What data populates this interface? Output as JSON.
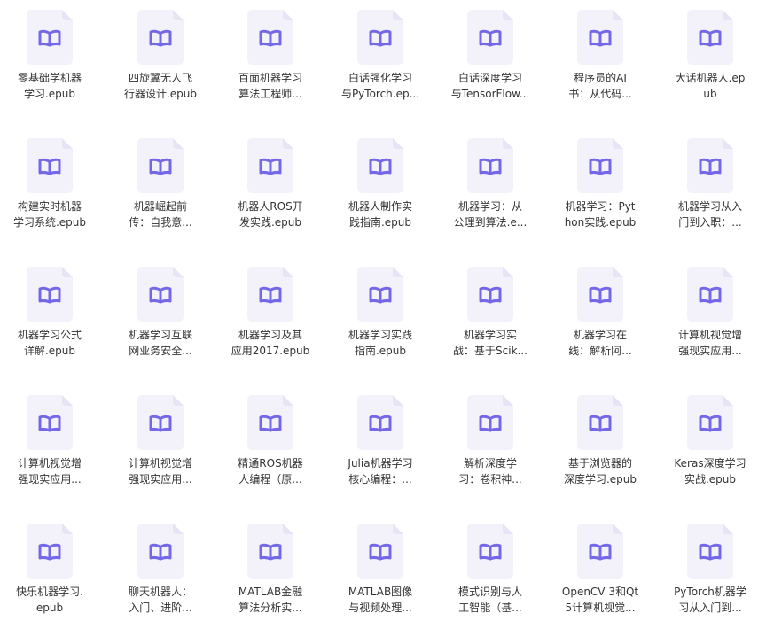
{
  "theme": {
    "icon_accent": "#7468E8",
    "icon_page": "#F3F2FB",
    "icon_fold": "#E6E4F5",
    "text_color": "#333333"
  },
  "files": [
    {
      "name_lines": [
        "零基础学机器",
        "学习.epub"
      ],
      "icon": "book-icon"
    },
    {
      "name_lines": [
        "四旋翼无人飞",
        "行器设计.epub"
      ],
      "icon": "book-icon"
    },
    {
      "name_lines": [
        "百面机器学习",
        "算法工程师..."
      ],
      "icon": "book-icon"
    },
    {
      "name_lines": [
        "白话强化学习",
        "与PyTorch.ep..."
      ],
      "icon": "book-icon"
    },
    {
      "name_lines": [
        "白话深度学习",
        "与TensorFlow..."
      ],
      "icon": "book-icon"
    },
    {
      "name_lines": [
        "程序员的AI",
        "书：从代码..."
      ],
      "icon": "book-icon"
    },
    {
      "name_lines": [
        "大话机器人.ep",
        "ub"
      ],
      "icon": "book-icon"
    },
    {
      "name_lines": [
        "构建实时机器",
        "学习系统.epub"
      ],
      "icon": "book-icon"
    },
    {
      "name_lines": [
        "机器崛起前",
        "传：自我意..."
      ],
      "icon": "book-icon"
    },
    {
      "name_lines": [
        "机器人ROS开",
        "发实践.epub"
      ],
      "icon": "book-icon"
    },
    {
      "name_lines": [
        "机器人制作实",
        "践指南.epub"
      ],
      "icon": "book-icon"
    },
    {
      "name_lines": [
        "机器学习：从",
        "公理到算法.e..."
      ],
      "icon": "book-icon"
    },
    {
      "name_lines": [
        "机器学习：Pyt",
        "hon实践.epub"
      ],
      "icon": "book-icon"
    },
    {
      "name_lines": [
        "机器学习从入",
        "门到入职：..."
      ],
      "icon": "book-icon"
    },
    {
      "name_lines": [
        "机器学习公式",
        "详解.epub"
      ],
      "icon": "book-icon"
    },
    {
      "name_lines": [
        "机器学习互联",
        "网业务安全..."
      ],
      "icon": "book-icon"
    },
    {
      "name_lines": [
        "机器学习及其",
        "应用2017.epub"
      ],
      "icon": "book-icon"
    },
    {
      "name_lines": [
        "机器学习实践",
        "指南.epub"
      ],
      "icon": "book-icon"
    },
    {
      "name_lines": [
        "机器学习实",
        "战：基于Scik..."
      ],
      "icon": "book-icon"
    },
    {
      "name_lines": [
        "机器学习在",
        "线：解析阿..."
      ],
      "icon": "book-icon"
    },
    {
      "name_lines": [
        "计算机视觉增",
        "强现实应用..."
      ],
      "icon": "book-icon"
    },
    {
      "name_lines": [
        "计算机视觉增",
        "强现实应用..."
      ],
      "icon": "book-icon"
    },
    {
      "name_lines": [
        "计算机视觉增",
        "强现实应用..."
      ],
      "icon": "book-icon"
    },
    {
      "name_lines": [
        "精通ROS机器",
        "人编程（原..."
      ],
      "icon": "book-icon"
    },
    {
      "name_lines": [
        "Julia机器学习",
        "核心编程：..."
      ],
      "icon": "book-icon"
    },
    {
      "name_lines": [
        "解析深度学",
        "习：卷积神..."
      ],
      "icon": "book-icon"
    },
    {
      "name_lines": [
        "基于浏览器的",
        "深度学习.epub"
      ],
      "icon": "book-icon"
    },
    {
      "name_lines": [
        "Keras深度学习",
        "实战.epub"
      ],
      "icon": "book-icon"
    },
    {
      "name_lines": [
        "快乐机器学习.",
        "epub"
      ],
      "icon": "book-icon"
    },
    {
      "name_lines": [
        "聊天机器人：",
        "入门、进阶..."
      ],
      "icon": "book-icon"
    },
    {
      "name_lines": [
        "MATLAB金融",
        "算法分析实..."
      ],
      "icon": "book-icon"
    },
    {
      "name_lines": [
        "MATLAB图像",
        "与视频处理..."
      ],
      "icon": "book-icon"
    },
    {
      "name_lines": [
        "模式识别与人",
        "工智能（基..."
      ],
      "icon": "book-icon"
    },
    {
      "name_lines": [
        "OpenCV 3和Qt",
        "5计算机视觉..."
      ],
      "icon": "book-icon"
    },
    {
      "name_lines": [
        "PyTorch机器学",
        "习从入门到..."
      ],
      "icon": "book-icon"
    }
  ]
}
